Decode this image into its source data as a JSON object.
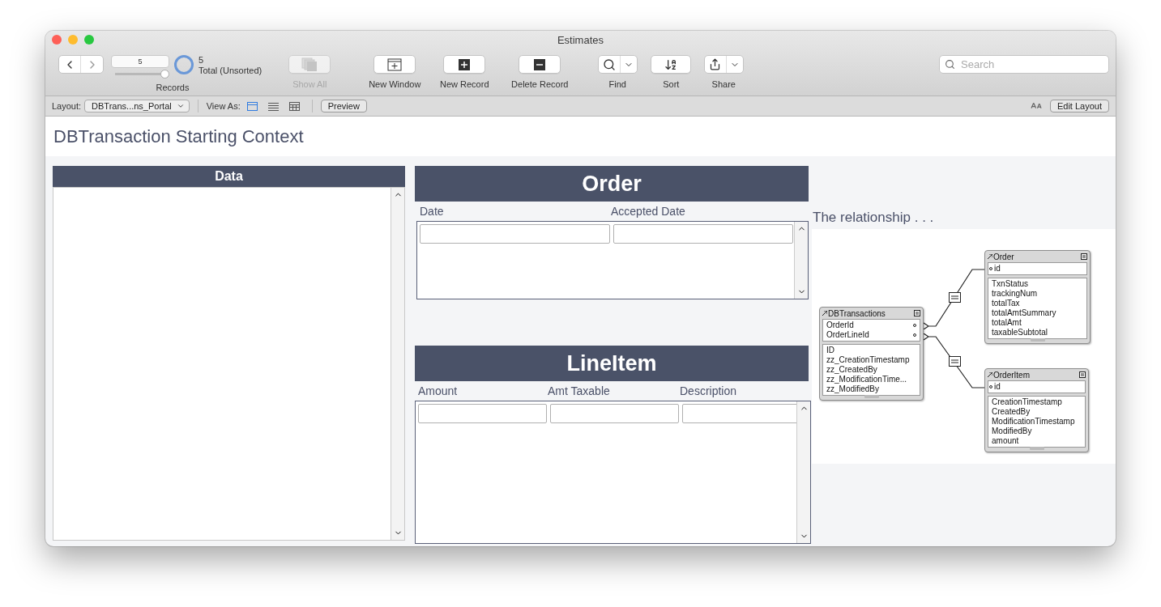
{
  "window": {
    "title": "Estimates"
  },
  "toolbar": {
    "record_number": "5",
    "records_label": "Records",
    "slider": {
      "level": 1
    },
    "found_count": "5",
    "found_status": "Total (Unsorted)",
    "buttons": [
      {
        "kind": "show-all",
        "label": "Show All",
        "disabled": true
      },
      {
        "kind": "new-window",
        "label": "New Window",
        "disabled": false
      },
      {
        "kind": "new-record",
        "label": "New Record",
        "disabled": false
      },
      {
        "kind": "delete-record",
        "label": "Delete Record",
        "disabled": false
      },
      {
        "kind": "find",
        "label": "Find",
        "disabled": false
      },
      {
        "kind": "sort",
        "label": "Sort",
        "disabled": false
      },
      {
        "kind": "share",
        "label": "Share",
        "disabled": false
      }
    ],
    "search": {
      "placeholder": "Search"
    }
  },
  "layout_bar": {
    "layout_label": "Layout:",
    "layout_value": "DBTrans...ns_Portal",
    "view_as_label": "View As:",
    "view_modes": [
      {
        "kind": "form",
        "selected": true
      },
      {
        "kind": "list",
        "selected": false
      },
      {
        "kind": "table",
        "selected": false
      }
    ],
    "preview": "Preview",
    "edit_layout": "Edit Layout"
  },
  "content": {
    "title": "DBTransaction Starting Context",
    "data_panel": {
      "header": "Data"
    },
    "order_portal": {
      "header": "Order",
      "columns": [
        "Date",
        "Accepted Date"
      ]
    },
    "line_item_portal": {
      "header": "LineItem",
      "columns": [
        "Amount",
        "Amt Taxable",
        "Description"
      ]
    },
    "relationship": {
      "caption": "The relationship . . .",
      "tables": [
        {
          "name": "DBTransactions",
          "keys": [
            "OrderId",
            "OrderLineId"
          ],
          "fields": [
            "ID",
            "zz_CreationTimestamp",
            "zz_CreatedBy",
            "zz_ModificationTime...",
            "zz_ModifiedBy"
          ]
        },
        {
          "name": "Order",
          "keys": [
            "id"
          ],
          "fields": [
            "TxnStatus",
            "trackingNum",
            "totalTax",
            "totalAmtSummary",
            "totalAmt",
            "taxableSubtotal"
          ]
        },
        {
          "name": "OrderItem",
          "keys": [
            "id"
          ],
          "fields": [
            "CreationTimestamp",
            "CreatedBy",
            "ModificationTimestamp",
            "ModifiedBy",
            "amount"
          ]
        }
      ]
    }
  }
}
